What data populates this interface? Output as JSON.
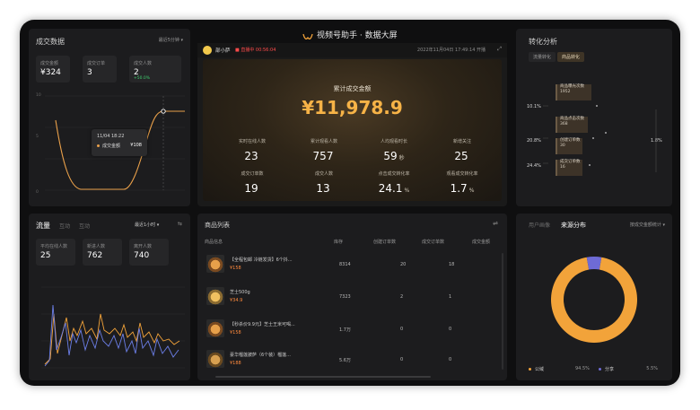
{
  "header": {
    "title": "视频号助手 · 数据大屏",
    "logo_icon": "channels-logo-icon"
  },
  "live": {
    "username": "部小萨",
    "status": "直播中 00:56:04",
    "started": "2022年11月04日 17:49:14 开播"
  },
  "deals": {
    "title": "成交数据",
    "range": "最近5分钟",
    "stats": [
      {
        "label": "成交金额",
        "value": "¥324"
      },
      {
        "label": "成交订单",
        "value": "3"
      },
      {
        "label": "成交人数",
        "value": "2",
        "sub": "+50.0%"
      }
    ],
    "axis_values": [
      "10",
      "5",
      "0"
    ],
    "tooltip": {
      "time": "11/04 18:22",
      "label": "成交金额",
      "value": "¥108"
    }
  },
  "main": {
    "total_label": "累计成交金额",
    "total_value": "¥11,978.9",
    "stats": [
      {
        "label": "实时在线人数",
        "value": "23",
        "unit": ""
      },
      {
        "label": "累计观看人数",
        "value": "757",
        "unit": ""
      },
      {
        "label": "人均观看时长",
        "value": "59",
        "unit": "秒"
      },
      {
        "label": "新增关注",
        "value": "25",
        "unit": ""
      },
      {
        "label": "成交订单数",
        "value": "19",
        "unit": ""
      },
      {
        "label": "成交人数",
        "value": "13",
        "unit": ""
      },
      {
        "label": "点击成交转化率",
        "value": "24.1",
        "unit": "%"
      },
      {
        "label": "观看成交转化率",
        "value": "1.7",
        "unit": "%"
      }
    ]
  },
  "conversion": {
    "title": "转化分析",
    "tabs": [
      "流量转化",
      "商品转化"
    ],
    "funnel": [
      {
        "label": "商品曝光次数",
        "value": "1952"
      },
      {
        "label": "商品点击次数",
        "value": "368"
      },
      {
        "label": "创建订单数",
        "value": "30"
      },
      {
        "label": "成交订单数",
        "value": "16"
      }
    ],
    "percents": [
      "10.1%",
      "20.8%",
      "24.4%"
    ],
    "right_percent": "1.8%"
  },
  "traffic": {
    "tabs": [
      "流量",
      "互动",
      "互动"
    ],
    "range": "最近1小时",
    "stats": [
      {
        "label": "平均在线人数",
        "value": "25"
      },
      {
        "label": "新进人数",
        "value": "762"
      },
      {
        "label": "离开人数",
        "value": "740"
      }
    ]
  },
  "products": {
    "title": "商品列表",
    "columns": [
      "商品信息",
      "库存",
      "创建订单数",
      "成交订单数",
      "成交金额"
    ],
    "rows": [
      {
        "name": "【全程包邮 冷链发货】6个抖...",
        "price": "¥158",
        "stock": "8314",
        "created": "20",
        "deals": "18",
        "amount": ""
      },
      {
        "name": "芝士500g",
        "price": "¥34.9",
        "stock": "7323",
        "created": "2",
        "deals": "1",
        "amount": ""
      },
      {
        "name": "【秒杀价9.9元】芝士王米可喝...",
        "price": "¥158",
        "stock": "1.7万",
        "created": "0",
        "deals": "0",
        "amount": ""
      },
      {
        "name": "豪华榴莲披萨（6个装）榴莲...",
        "price": "¥188",
        "stock": "5.6万",
        "created": "0",
        "deals": "0",
        "amount": ""
      }
    ]
  },
  "source": {
    "tabs": [
      "用户画像",
      "来源分布"
    ],
    "range": "按成交金额统计",
    "legend": [
      {
        "name": "公域",
        "value": "94.5%",
        "color": "#f2a33a"
      },
      {
        "name": "分享",
        "value": "5.5%",
        "color": "#6e6bd6"
      }
    ],
    "chart_data": {
      "type": "pie",
      "categories": [
        "公域",
        "分享"
      ],
      "values": [
        94.5,
        5.5
      ]
    }
  }
}
